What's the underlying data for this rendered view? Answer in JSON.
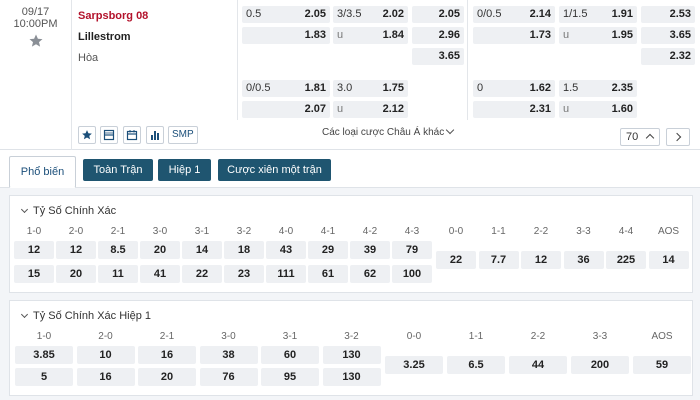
{
  "match": {
    "date": "09/17",
    "time": "10:00PM",
    "home": "Sarpsborg 08",
    "away": "Lillestrom",
    "draw": "Hòa"
  },
  "odds_row1": {
    "a": [
      {
        "hl": "0.5",
        "pr": "2.05"
      },
      {
        "hl": "",
        "pr": "1.83"
      }
    ],
    "b": [
      {
        "hl": "3/3.5",
        "pr": "2.02"
      },
      {
        "hl": "u",
        "pr": "1.84"
      }
    ],
    "c": [
      "2.05",
      "2.96",
      "3.65"
    ],
    "d": [
      {
        "hl": "0/0.5",
        "pr": "2.14"
      },
      {
        "hl": "",
        "pr": "1.73"
      }
    ],
    "e": [
      {
        "hl": "1/1.5",
        "pr": "1.91"
      },
      {
        "hl": "u",
        "pr": "1.95"
      }
    ],
    "f": [
      "2.53",
      "3.65",
      "2.32"
    ]
  },
  "odds_row2": {
    "a": [
      {
        "hl": "0/0.5",
        "pr": "1.81"
      },
      {
        "hl": "",
        "pr": "2.07"
      }
    ],
    "b": [
      {
        "hl": "3.0",
        "pr": "1.75"
      },
      {
        "hl": "u",
        "pr": "2.12"
      }
    ],
    "d": [
      {
        "hl": "0",
        "pr": "1.62"
      },
      {
        "hl": "",
        "pr": "2.31"
      }
    ],
    "e": [
      {
        "hl": "1.5",
        "pr": "2.35"
      },
      {
        "hl": "u",
        "pr": "1.60"
      }
    ]
  },
  "toolbar": {
    "smp": "SMP",
    "more_bets": "Các loại cược Châu Á khác",
    "count": "70"
  },
  "tabs": [
    "Phổ biến",
    "Toàn Trận",
    "Hiệp 1",
    "Cược xiên một trận"
  ],
  "correct_score": {
    "title": "Tỷ Số Chính Xác",
    "home_labels": [
      "1-0",
      "2-0",
      "2-1",
      "3-0",
      "3-1",
      "3-2",
      "4-0",
      "4-1",
      "4-2",
      "4-3"
    ],
    "home_values": [
      "12",
      "12",
      "8.5",
      "20",
      "14",
      "18",
      "43",
      "29",
      "39",
      "79"
    ],
    "away_values": [
      "15",
      "20",
      "11",
      "41",
      "22",
      "23",
      "111",
      "61",
      "62",
      "100"
    ],
    "draw_labels": [
      "0-0",
      "1-1",
      "2-2",
      "3-3",
      "4-4",
      "AOS"
    ],
    "draw_values": [
      "22",
      "7.7",
      "12",
      "36",
      "225",
      "14"
    ]
  },
  "correct_score_h1": {
    "title": "Tỷ Số Chính Xác Hiệp 1",
    "home_labels": [
      "1-0",
      "2-0",
      "2-1",
      "3-0",
      "3-1",
      "3-2"
    ],
    "home_values": [
      "3.85",
      "10",
      "16",
      "38",
      "60",
      "130"
    ],
    "away_values": [
      "5",
      "16",
      "20",
      "76",
      "95",
      "130"
    ],
    "draw_labels": [
      "0-0",
      "1-1",
      "2-2",
      "3-3",
      "AOS"
    ],
    "draw_values": [
      "3.25",
      "6.5",
      "44",
      "200",
      "59"
    ]
  }
}
